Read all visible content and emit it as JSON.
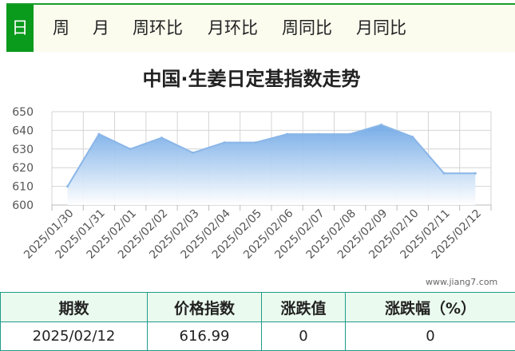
{
  "tabs": [
    {
      "label": "日",
      "active": true
    },
    {
      "label": "周",
      "active": false
    },
    {
      "label": "月",
      "active": false
    },
    {
      "label": "周环比",
      "active": false
    },
    {
      "label": "月环比",
      "active": false
    },
    {
      "label": "周同比",
      "active": false
    },
    {
      "label": "月同比",
      "active": false
    }
  ],
  "chart_data": {
    "type": "area",
    "title": "中国·生姜日定基指数走势",
    "xlabel": "",
    "ylabel": "",
    "categories": [
      "2025/01/30",
      "2025/01/31",
      "2025/02/01",
      "2025/02/02",
      "2025/02/03",
      "2025/02/04",
      "2025/02/05",
      "2025/02/06",
      "2025/02/07",
      "2025/02/08",
      "2025/02/09",
      "2025/02/10",
      "2025/02/11",
      "2025/02/12"
    ],
    "series": [
      {
        "values": [
          610,
          638,
          630,
          636,
          628,
          633.5,
          633.5,
          638,
          638,
          638,
          643,
          636.5,
          617,
          617
        ]
      }
    ],
    "ylim": [
      600,
      650
    ],
    "yticks": [
      600,
      610,
      620,
      630,
      640,
      650
    ],
    "grid": true,
    "line_color": "#8ab6e8",
    "fill_top_color": "#6fa8e6",
    "fill_bottom_color": "#ffffff"
  },
  "watermark": "www.jiang7.com",
  "table": {
    "headers": [
      "期数",
      "价格指数",
      "涨跌值",
      "涨跌幅（%）"
    ],
    "rows": [
      [
        "2025/02/12",
        "616.99",
        "0",
        "0"
      ]
    ]
  },
  "colors": {
    "tab_active": "#0a9a1c",
    "tabbar_bg": "#fbfcee",
    "table_border": "#1f9b8b",
    "table_header_bg": "#ebfaef"
  }
}
